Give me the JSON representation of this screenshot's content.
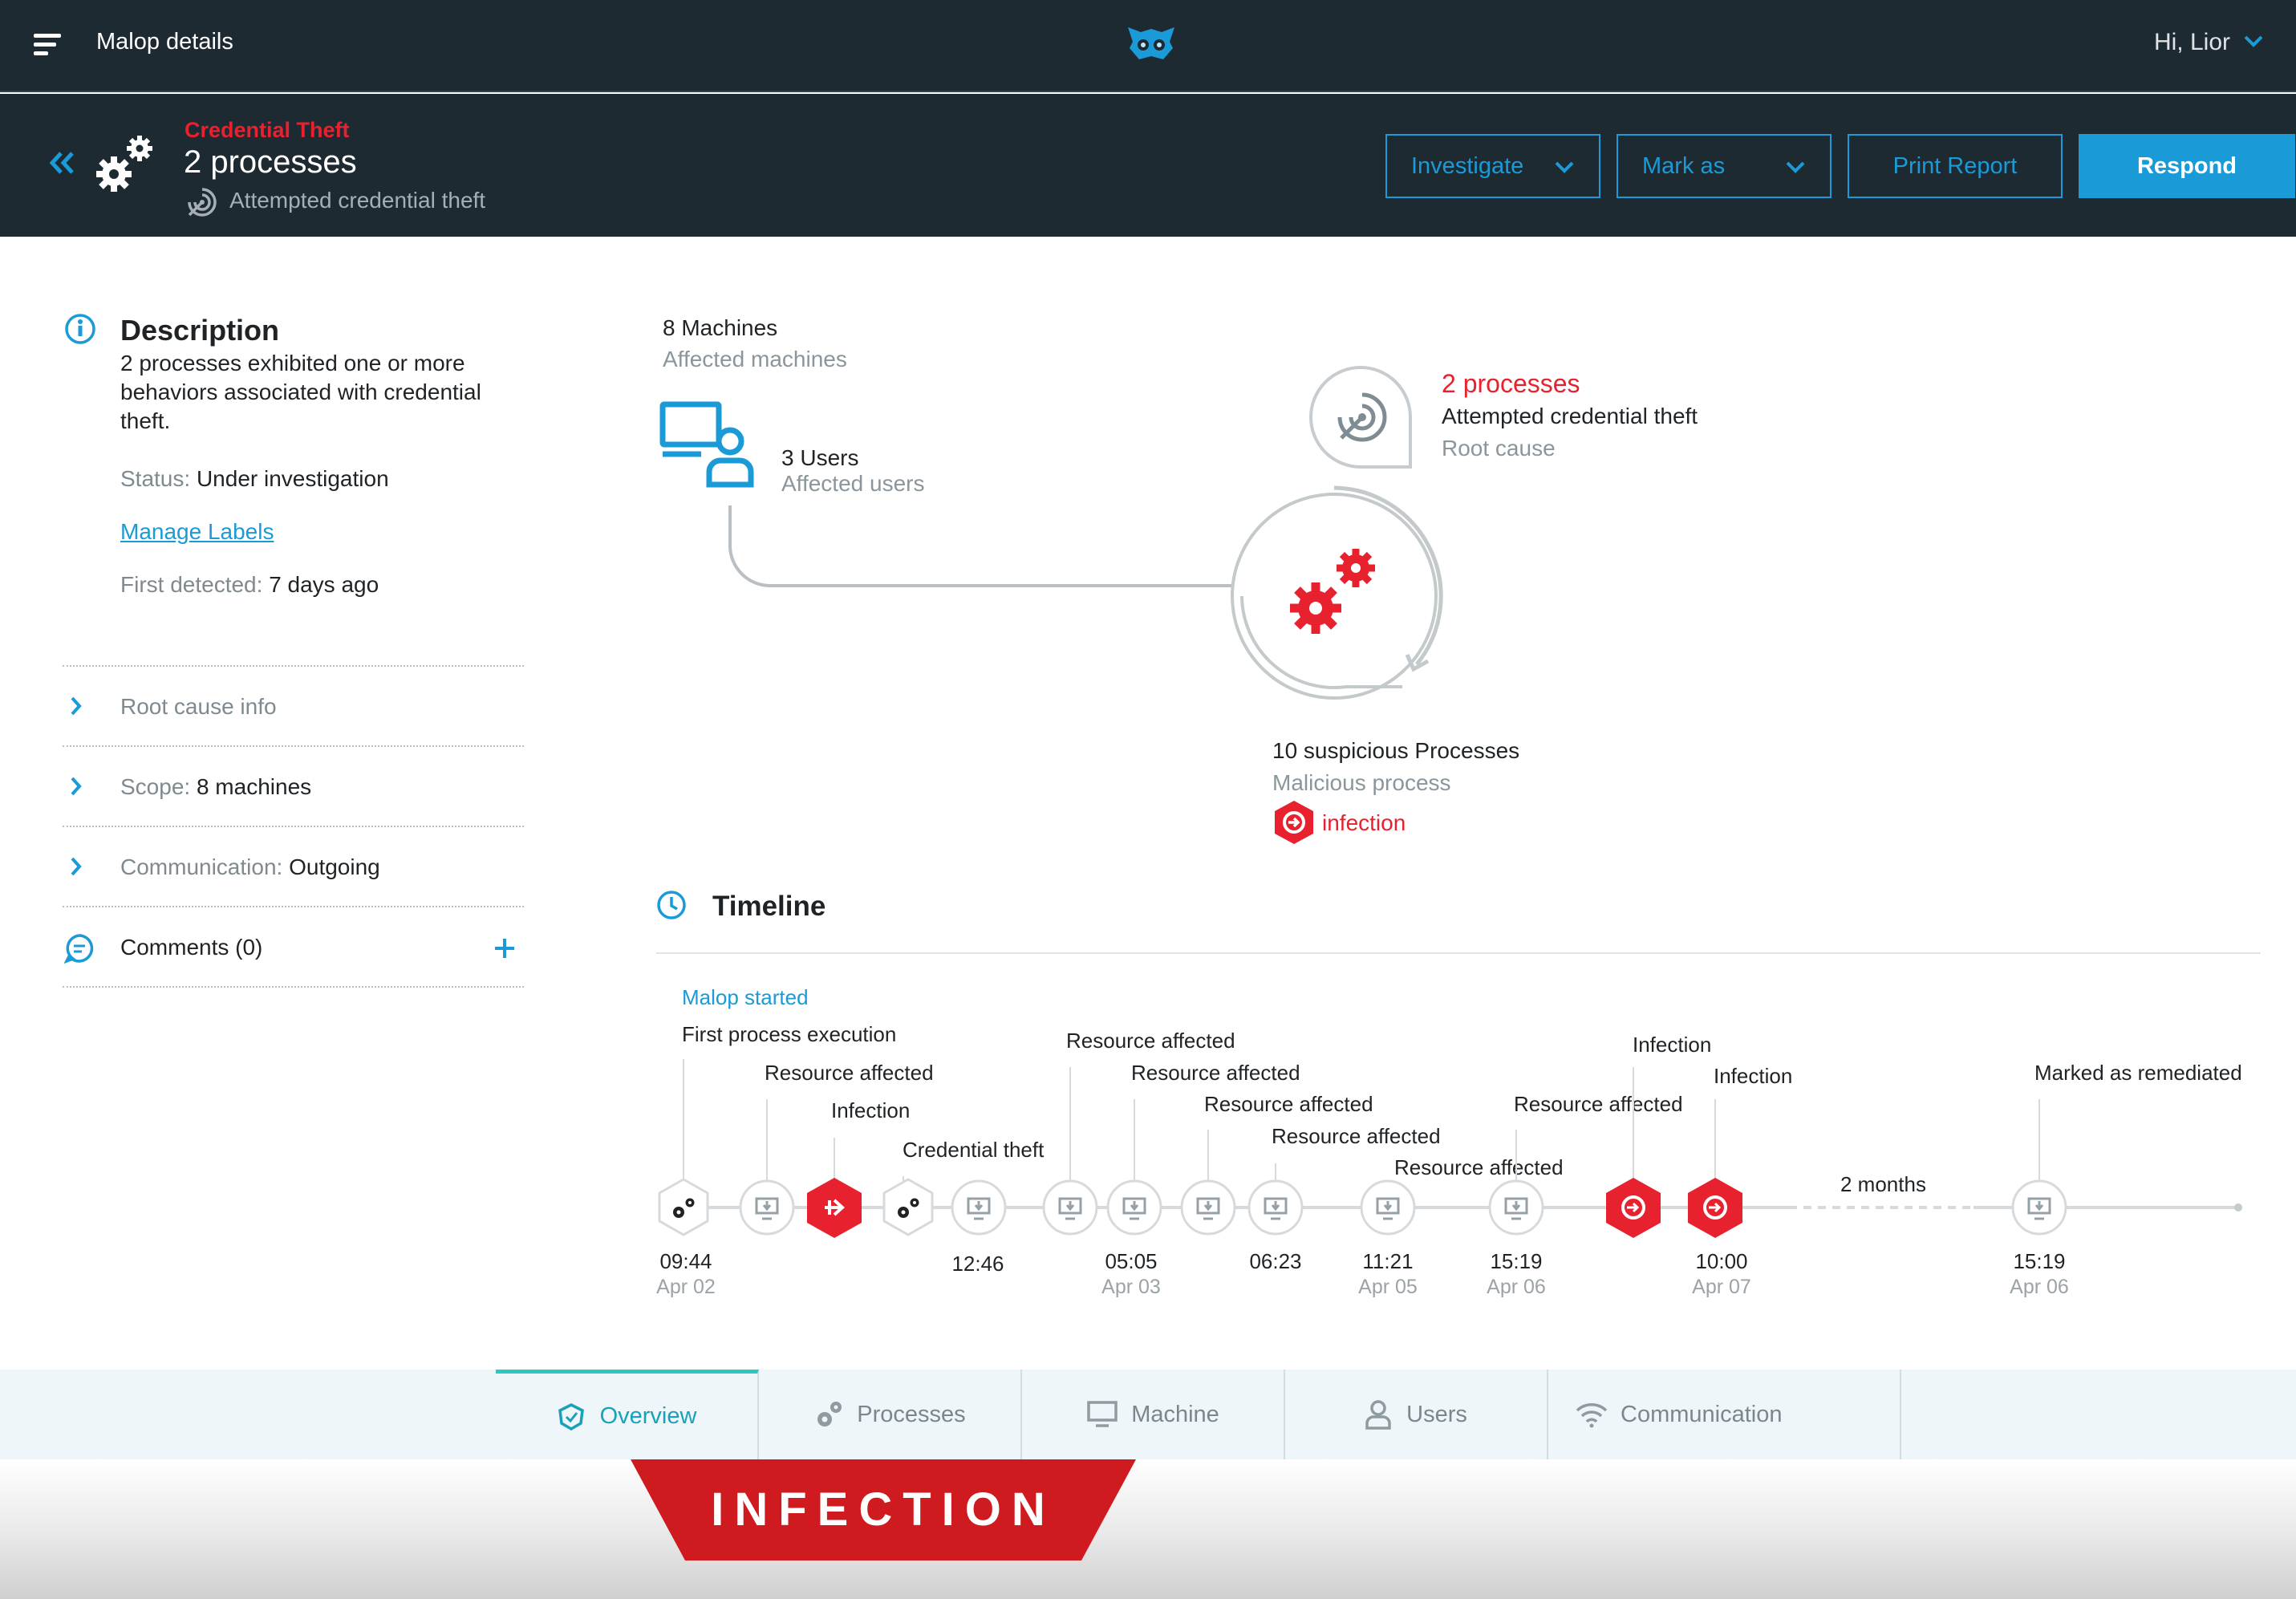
{
  "topbar": {
    "title": "Malop details",
    "user_greeting": "Hi, Lior"
  },
  "header": {
    "malop_type": "Credential Theft",
    "title": "2 processes",
    "subtitle": "Attempted credential theft",
    "buttons": {
      "investigate": "Investigate",
      "mark_as": "Mark as",
      "print_report": "Print Report",
      "respond": "Respond"
    }
  },
  "description": {
    "heading": "Description",
    "text_lines": [
      "2 processes exhibited one or more",
      "behaviors associated with credential",
      "theft."
    ],
    "status_label": "Status:",
    "status_value": "Under investigation",
    "manage_labels": "Manage Labels",
    "first_detected_label": "First detected:",
    "first_detected_value": "7 days ago"
  },
  "sections": {
    "root_cause": "Root cause info",
    "scope_label": "Scope:",
    "scope_value": "8 machines",
    "communication_label": "Communication:",
    "communication_value": "Outgoing",
    "comments": "Comments (0)"
  },
  "overview": {
    "machines_count": "8 Machines",
    "machines_label": "Affected machines",
    "users_count": "3 Users",
    "users_label": "Affected users",
    "root_title": "2 processes",
    "root_sub": "Attempted credential theft",
    "root_label": "Root cause",
    "proc_count": "10 suspicious Processes",
    "proc_label": "Malicious process",
    "infection_tag": "infection"
  },
  "timeline": {
    "heading": "Timeline",
    "malop_started": "Malop started",
    "events": [
      "First process execution",
      "Resource affected",
      "Infection",
      "Credential theft",
      "Resource affected",
      "Resource affected",
      "Resource affected",
      "Resource affected",
      "Resource affected",
      "Resource affected",
      "Infection",
      "Infection",
      "Marked as remediated"
    ],
    "gap_label": "2 months",
    "times": [
      "09:44",
      "12:46",
      "05:05",
      "06:23",
      "11:21",
      "15:19",
      "10:00",
      "15:19"
    ],
    "dates": [
      "Apr 02",
      "Apr 03",
      "Apr 05",
      "Apr 06",
      "Apr 07",
      "Apr 06"
    ]
  },
  "tabs": [
    "Overview",
    "Processes",
    "Machine",
    "Users",
    "Communication"
  ],
  "banner": "INFECTION",
  "colors": {
    "accent": "#1a9bd7",
    "alert_red": "#e8212e",
    "dark_bg": "#1e2a32",
    "teal": "#2cc7c1"
  }
}
